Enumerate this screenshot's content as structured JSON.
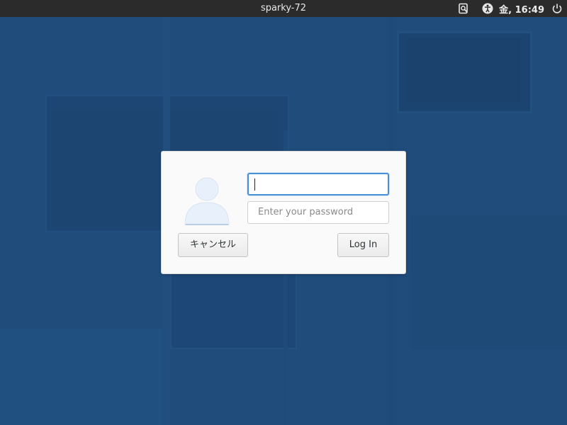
{
  "topbar": {
    "hostname": "sparky-72",
    "clock": "金, 16:49",
    "icons": [
      "screen-reader-icon",
      "accessibility-icon",
      "power-icon"
    ]
  },
  "login": {
    "username_value": "",
    "password_placeholder": "Enter your password",
    "cancel_label": "キャンセル",
    "login_label": "Log In",
    "avatar_icon": "user-avatar-icon"
  },
  "colors": {
    "desktop_bg": "#1f4c7b",
    "topbar_bg": "#2b2b2b",
    "focus_ring": "#4a90d9",
    "card_bg": "#fafafa"
  }
}
